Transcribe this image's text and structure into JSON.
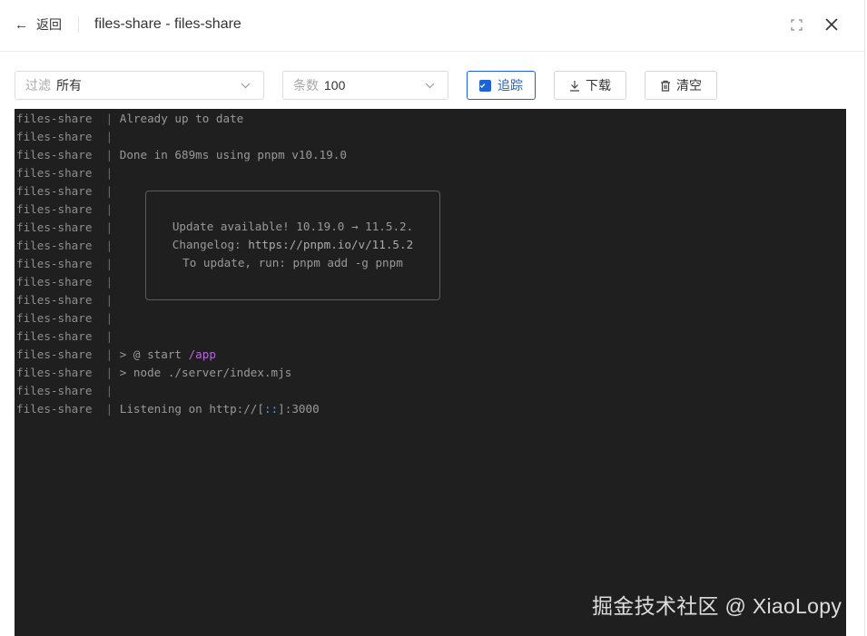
{
  "header": {
    "back_label": "返回",
    "title": "files-share - files-share"
  },
  "toolbar": {
    "filter": {
      "prefix": "过滤",
      "value": "所有"
    },
    "count": {
      "prefix": "条数",
      "value": "100"
    },
    "follow": {
      "label": "追踪",
      "checked": true
    },
    "download": {
      "label": "下载"
    },
    "clear": {
      "label": "清空"
    }
  },
  "terminal": {
    "prefix": "files-share",
    "separator": "|",
    "lines": [
      {
        "text": "Already up to date"
      },
      {
        "text": ""
      },
      {
        "text": "Done in 689ms using pnpm v10.19.0"
      },
      {
        "text": ""
      },
      {
        "text": ""
      },
      {
        "text": ""
      },
      {
        "text": ""
      },
      {
        "text": ""
      },
      {
        "text": ""
      },
      {
        "text": ""
      },
      {
        "text": ""
      },
      {
        "text": ""
      },
      {
        "text": ""
      },
      {
        "text": "> @ start ",
        "accent": "/app"
      },
      {
        "text": "> node ./server/index.mjs"
      },
      {
        "text": ""
      },
      {
        "text": "Listening on http://[",
        "accent": "::",
        "suffix": "]:3000"
      }
    ],
    "update_box": {
      "line1": "Update available! 10.19.0 → 11.5.2.",
      "line2_label": "Changelog: ",
      "line2_link": "https://pnpm.io/v/11.5.2",
      "line3": "To update, run: pnpm add -g pnpm"
    }
  },
  "watermark": "掘金技术社区 @ XiaoLopy",
  "colors": {
    "accent": "#1e63d6",
    "terminal_bg": "#1f1f1f",
    "terminal_text": "#8e8e8e",
    "path_purple": "#b36ad6"
  }
}
